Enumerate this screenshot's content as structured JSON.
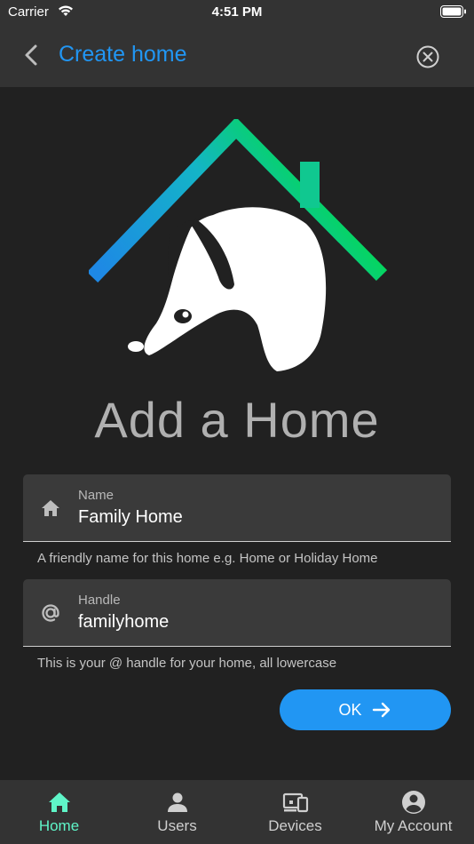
{
  "status_bar": {
    "carrier": "Carrier",
    "time": "4:51 PM"
  },
  "app_bar": {
    "title": "Create home",
    "back_icon": "chevron-left-icon",
    "close_icon": "close-circle-icon"
  },
  "logo": {
    "icon": "badger-house-logo"
  },
  "heading": "Add a Home",
  "form": {
    "name": {
      "label": "Name",
      "value": "Family Home",
      "help": "A friendly name for this home e.g. Home or Holiday Home",
      "icon": "house-icon"
    },
    "handle": {
      "label": "Handle",
      "value": "familyhome",
      "help": "This is your @ handle for your home, all lowercase",
      "icon": "at-icon"
    },
    "ok_label": "OK"
  },
  "bottom_nav": {
    "items": [
      {
        "label": "Home",
        "icon": "house-icon",
        "active": true
      },
      {
        "label": "Users",
        "icon": "person-icon",
        "active": false
      },
      {
        "label": "Devices",
        "icon": "devices-icon",
        "active": false
      },
      {
        "label": "My Account",
        "icon": "account-circle-icon",
        "active": false
      }
    ]
  },
  "colors": {
    "accent": "#2196f3",
    "active_nav": "#5ff5c8",
    "background": "#212121",
    "bar": "#333333"
  }
}
